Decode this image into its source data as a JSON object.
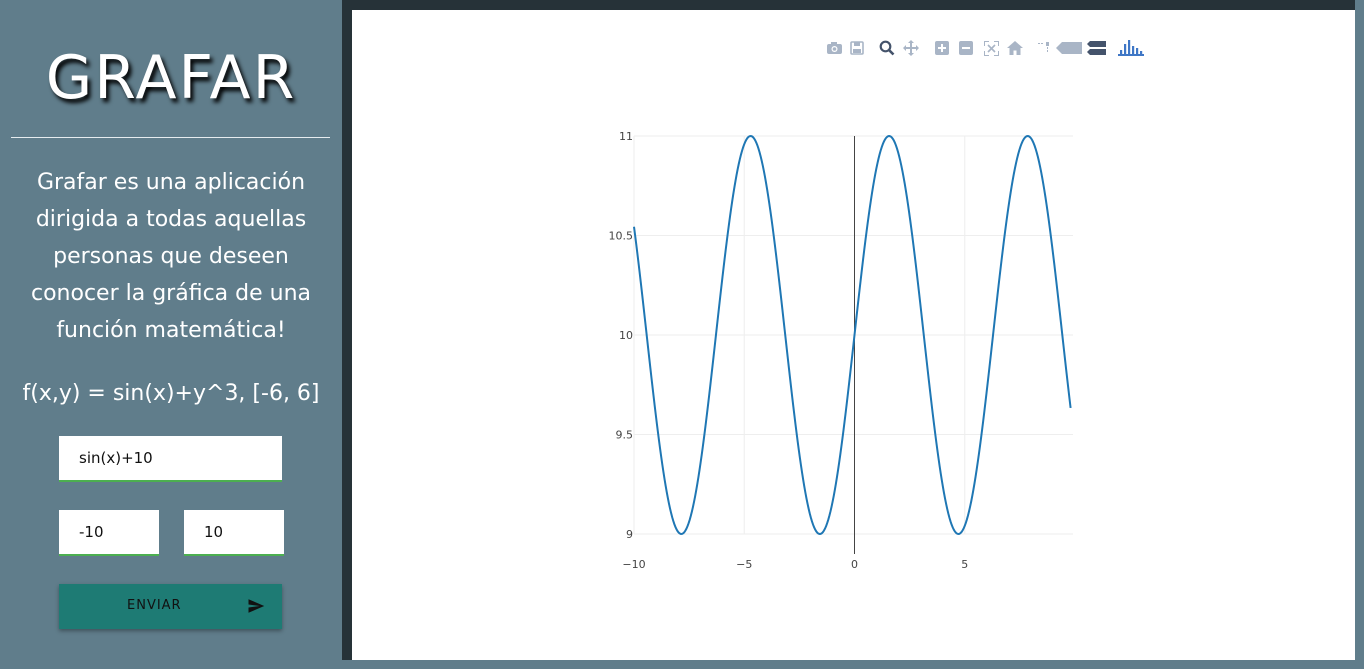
{
  "sidebar": {
    "title": "GRAFAR",
    "description": "Grafar es una aplicación dirigida a todas aquellas personas que deseen conocer la gráfica de una función matemática!",
    "example": "f(x,y) = sin(x)+y^3, [-6, 6]",
    "function_input": {
      "value": "sin(x)+10"
    },
    "min_input": {
      "value": "-10"
    },
    "max_input": {
      "value": "10"
    },
    "send_button": {
      "label": "ENVIAR",
      "icon": "send-icon"
    }
  },
  "colors": {
    "sidebar": "#607d8b",
    "frame": "#263238",
    "button": "#1e7b74",
    "input_underline": "#4caf50",
    "trace": "#1f77b4",
    "modebar_icon": "#a9b5c6"
  },
  "modebar": {
    "icons": [
      "camera-icon",
      "save-icon",
      "zoom-icon",
      "pan-icon",
      "zoom-in-icon",
      "zoom-out-icon",
      "autoscale-icon",
      "reset-axes-icon",
      "spike-lines-icon",
      "hover-closest-icon",
      "hover-compare-icon",
      "plotly-logo-icon"
    ]
  },
  "chart_data": {
    "type": "line",
    "function": "sin(x)+10",
    "x_range": [
      -10,
      9.8
    ],
    "ylim": [
      9,
      11
    ],
    "x_ticks": [
      -10,
      -5,
      0,
      5
    ],
    "x_tick_labels": [
      "−10",
      "−5",
      "0",
      "5"
    ],
    "y_ticks": [
      9,
      9.5,
      10,
      10.5,
      11
    ],
    "y_tick_labels": [
      "9",
      "9.5",
      "10",
      "10.5",
      "11"
    ],
    "grid": true,
    "zero_line": true,
    "series": [
      {
        "color": "#1f77b4"
      }
    ]
  }
}
